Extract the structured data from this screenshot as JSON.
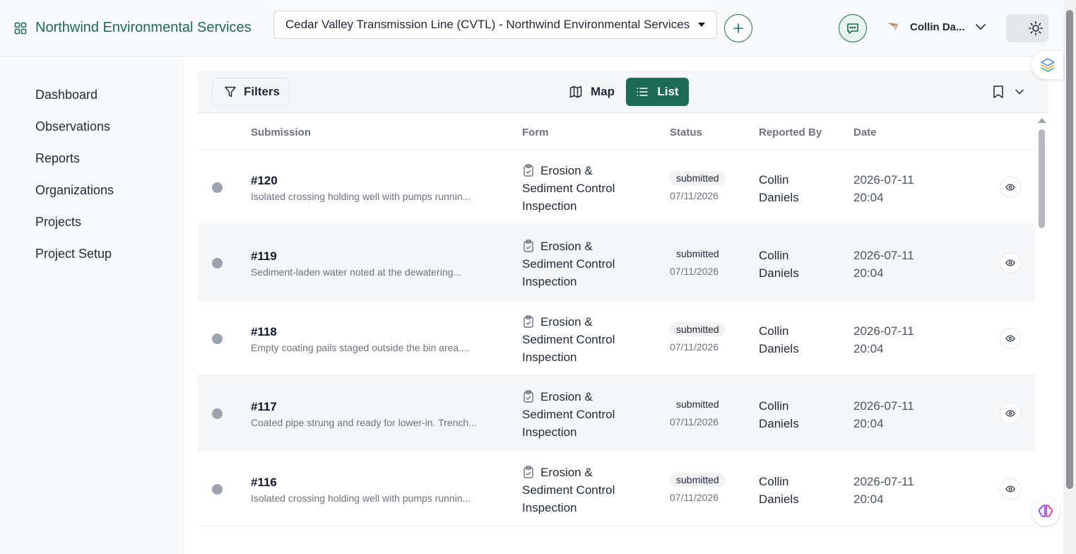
{
  "header": {
    "brand": "Northwind Environmental Services",
    "project": "Cedar Valley Transmission Line (CVTL) - Northwind Environmental Services",
    "user_name": "Collin Da..."
  },
  "sidebar": {
    "items": [
      "Dashboard",
      "Observations",
      "Reports",
      "Organizations",
      "Projects",
      "Project Setup"
    ]
  },
  "toolbar": {
    "filters_label": "Filters",
    "map_label": "Map",
    "list_label": "List"
  },
  "table": {
    "columns": [
      "Submission",
      "Form",
      "Status",
      "Reported By",
      "Date"
    ],
    "rows": [
      {
        "id": "#120",
        "desc": "Isolated crossing holding well with pumps runnin...",
        "form": "Erosion & Sediment Control Inspection",
        "status": "submitted",
        "status_date": "07/11/2026",
        "reported_by": "Collin Daniels",
        "date": "2026-07-11 20:04"
      },
      {
        "id": "#119",
        "desc": "Sediment-laden water noted at the dewatering...",
        "form": "Erosion & Sediment Control Inspection",
        "status": "submitted",
        "status_date": "07/11/2026",
        "reported_by": "Collin Daniels",
        "date": "2026-07-11 20:04"
      },
      {
        "id": "#118",
        "desc": "Empty coating pails staged outside the bin area....",
        "form": "Erosion & Sediment Control Inspection",
        "status": "submitted",
        "status_date": "07/11/2026",
        "reported_by": "Collin Daniels",
        "date": "2026-07-11 20:04"
      },
      {
        "id": "#117",
        "desc": "Coated pipe strung and ready for lower-in. Trench...",
        "form": "Erosion & Sediment Control Inspection",
        "status": "submitted",
        "status_date": "07/11/2026",
        "reported_by": "Collin Daniels",
        "date": "2026-07-11 20:04"
      },
      {
        "id": "#116",
        "desc": "Isolated crossing holding well with pumps runnin...",
        "form": "Erosion & Sediment Control Inspection",
        "status": "submitted",
        "status_date": "07/11/2026",
        "reported_by": "Collin Daniels",
        "date": "2026-07-11 20:04"
      }
    ]
  },
  "colors": {
    "brand_green": "#1b6b55",
    "status_dot": "#9ca3af"
  },
  "icons": [
    "grid-icon",
    "caret-down-icon",
    "plus-icon",
    "chat-icon",
    "chevron-down-icon",
    "sun-icon",
    "filter-icon",
    "map-icon",
    "list-icon",
    "bookmark-icon",
    "clipboard-icon",
    "eye-icon",
    "brain-icon"
  ]
}
